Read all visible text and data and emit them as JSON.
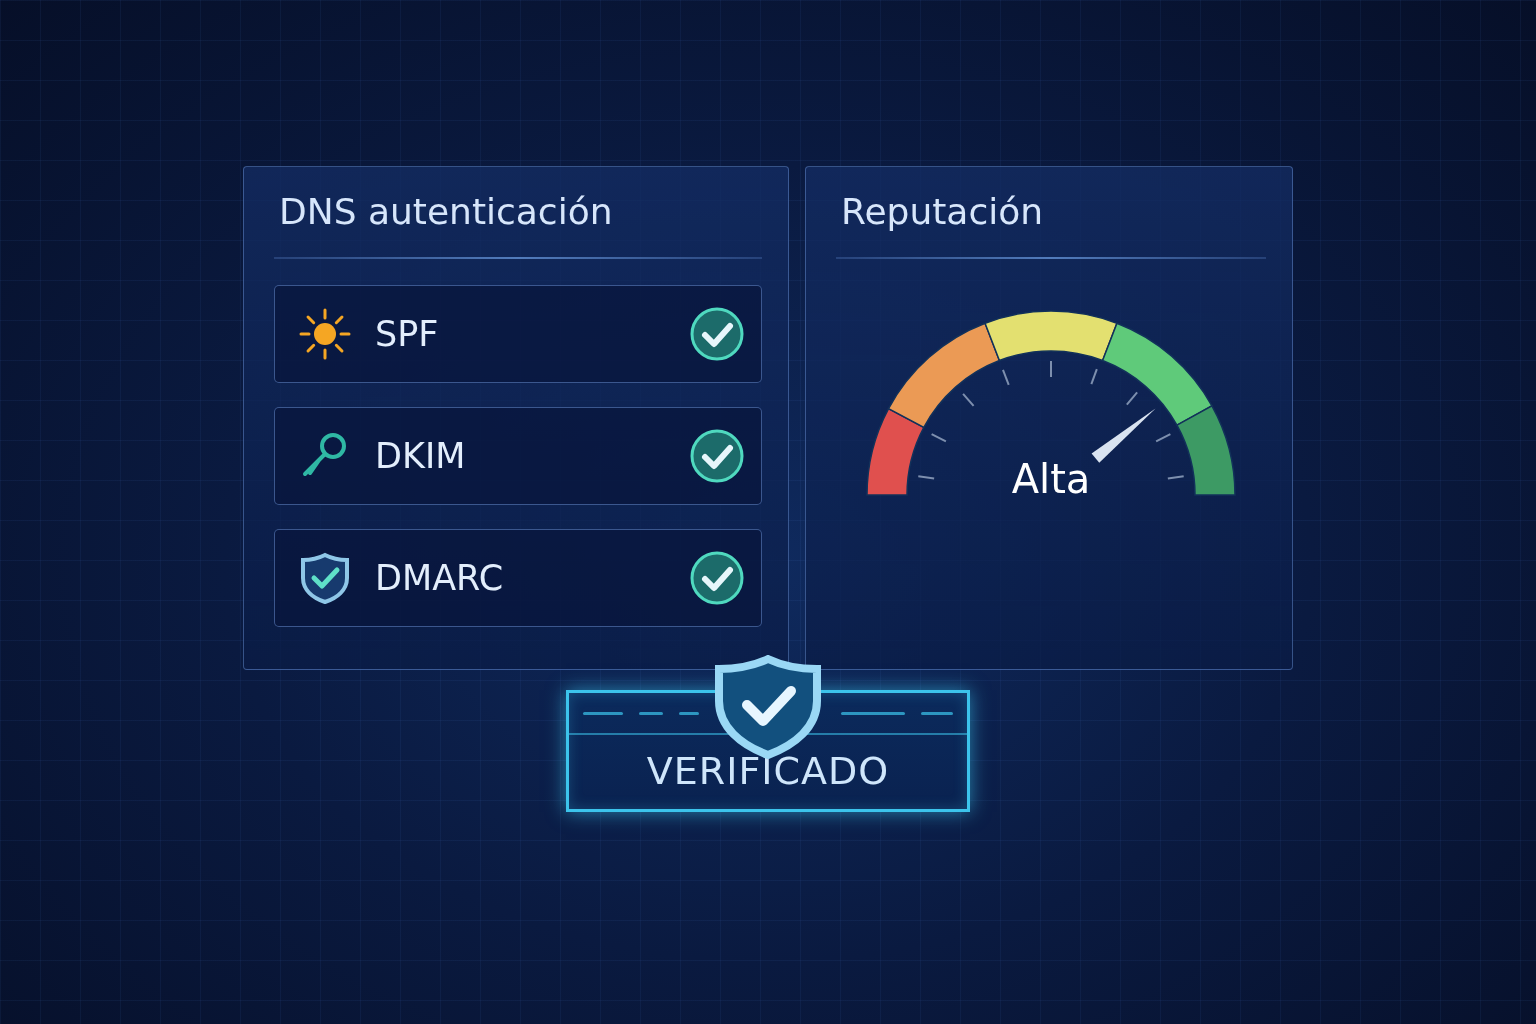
{
  "auth_panel": {
    "title": "DNS autenticación",
    "records": [
      {
        "kind": "sun",
        "name": "SPF",
        "checked": true
      },
      {
        "kind": "key",
        "name": "DKIM",
        "checked": true
      },
      {
        "kind": "shield",
        "name": "DMARC",
        "checked": true
      }
    ]
  },
  "reputation_panel": {
    "title": "Reputación",
    "gauge": {
      "level": 0.78,
      "reading": "Alta"
    }
  },
  "badge": {
    "label": "VERIFICADO"
  }
}
